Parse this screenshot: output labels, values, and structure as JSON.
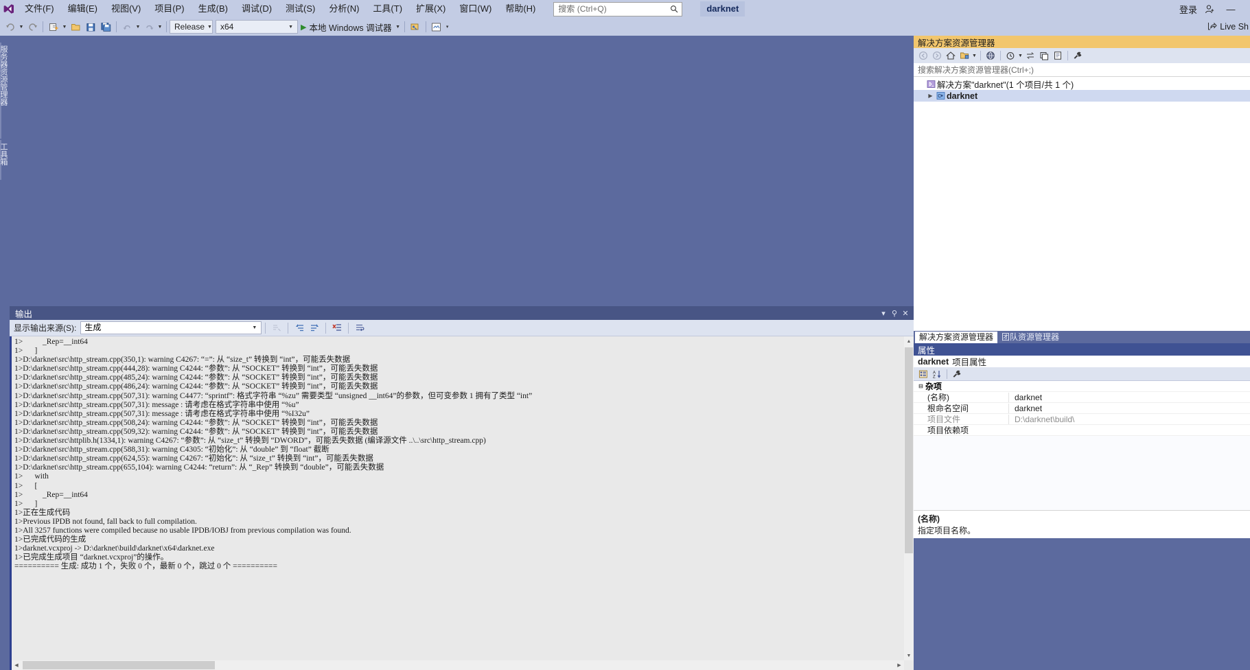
{
  "titlebar": {
    "menus": [
      "文件(F)",
      "编辑(E)",
      "视图(V)",
      "项目(P)",
      "生成(B)",
      "调试(D)",
      "测试(S)",
      "分析(N)",
      "工具(T)",
      "扩展(X)",
      "窗口(W)",
      "帮助(H)"
    ],
    "search_placeholder": "搜索 (Ctrl+Q)",
    "search_value": "",
    "project_chip": "darknet",
    "signin_label": "登录",
    "minimize_label": "—"
  },
  "toolbar": {
    "config": "Release",
    "platform": "x64",
    "run_label": "本地 Windows 调试器",
    "live_share": "Live Sh"
  },
  "left_strip": {
    "tabs": [
      "服务器资源管理器",
      "工具箱"
    ]
  },
  "output": {
    "title": "输出",
    "source_label": "显示输出来源(S):",
    "source_value": "生成",
    "controls": {
      "dropdown": "▾",
      "pin": "⚲",
      "close": "✕"
    },
    "lines": [
      "1>          _Rep=__int64",
      "1>      ]",
      "1>D:\\darknet\\src\\http_stream.cpp(350,1): warning C4267: “=”: 从 “size_t” 转换到 “int”，可能丢失数据",
      "1>D:\\darknet\\src\\http_stream.cpp(444,28): warning C4244: “参数”: 从 “SOCKET” 转换到 “int”，可能丢失数据",
      "1>D:\\darknet\\src\\http_stream.cpp(485,24): warning C4244: “参数”: 从 “SOCKET” 转换到 “int”，可能丢失数据",
      "1>D:\\darknet\\src\\http_stream.cpp(486,24): warning C4244: “参数”: 从 “SOCKET” 转换到 “int”，可能丢失数据",
      "1>D:\\darknet\\src\\http_stream.cpp(507,31): warning C4477: “sprintf”: 格式字符串 “%zu” 需要类型 “unsigned __int64”的参数，但可变参数 1 拥有了类型 “int”",
      "1>D:\\darknet\\src\\http_stream.cpp(507,31): message : 请考虑在格式字符串中使用 “%u”",
      "1>D:\\darknet\\src\\http_stream.cpp(507,31): message : 请考虑在格式字符串中使用 “%I32u”",
      "1>D:\\darknet\\src\\http_stream.cpp(508,24): warning C4244: “参数”: 从 “SOCKET” 转换到 “int”，可能丢失数据",
      "1>D:\\darknet\\src\\http_stream.cpp(509,32): warning C4244: “参数”: 从 “SOCKET” 转换到 “int”，可能丢失数据",
      "1>D:\\darknet\\src\\httplib.h(1334,1): warning C4267: “参数”: 从 “size_t” 转换到 “DWORD”，可能丢失数据 (编译源文件 ..\\..\\src\\http_stream.cpp)",
      "1>D:\\darknet\\src\\http_stream.cpp(588,31): warning C4305: “初始化”: 从 “double” 到 “float” 截断",
      "1>D:\\darknet\\src\\http_stream.cpp(624,55): warning C4267: “初始化”: 从 “size_t” 转换到 “int”，可能丢失数据",
      "1>D:\\darknet\\src\\http_stream.cpp(655,104): warning C4244: “return”: 从 “_Rep” 转换到 “double”，可能丢失数据",
      "1>      with",
      "1>      [",
      "1>          _Rep=__int64",
      "1>      ]",
      "1>正在生成代码",
      "1>Previous IPDB not found, fall back to full compilation.",
      "1>All 3257 functions were compiled because no usable IPDB/IOBJ from previous compilation was found.",
      "1>已完成代码的生成",
      "1>darknet.vcxproj -> D:\\darknet\\build\\darknet\\x64\\darknet.exe",
      "1>已完成生成项目 “darknet.vcxproj”的操作。",
      "========== 生成: 成功 1 个，失败 0 个，最新 0 个，跳过 0 个 =========="
    ]
  },
  "solution_explorer": {
    "title": "解决方案资源管理器",
    "search_placeholder": "搜索解决方案资源管理器(Ctrl+;)",
    "tree": [
      {
        "indent": 0,
        "expander": "",
        "icon": "solution-icon",
        "label": "解决方案\"darknet\"(1 个项目/共 1 个)",
        "bold": false,
        "selected": false
      },
      {
        "indent": 1,
        "expander": "▶",
        "icon": "cpp-project-icon",
        "label": "darknet",
        "bold": true,
        "selected": true
      }
    ],
    "tabs": [
      {
        "label": "解决方案资源管理器",
        "active": true
      },
      {
        "label": "团队资源管理器",
        "active": false
      }
    ]
  },
  "properties": {
    "title": "属性",
    "header_name": "darknet",
    "header_suffix": "项目属性",
    "categories": [
      {
        "name": "杂项",
        "expander": "⊟",
        "rows": [
          {
            "key": "(名称)",
            "value": "darknet",
            "dim": false
          },
          {
            "key": "根命名空间",
            "value": "darknet",
            "dim": false
          },
          {
            "key": "项目文件",
            "value": "D:\\darknet\\build\\",
            "dim": true
          },
          {
            "key": "项目依赖项",
            "value": "",
            "dim": false
          }
        ]
      }
    ],
    "description": {
      "name": "(名称)",
      "text": "指定项目名称。"
    }
  },
  "colors": {
    "titlebar_bg": "#c3cce4",
    "workspace_bg": "#5c6a9e",
    "panel_title_orange": "#f2c66d",
    "panel_title_blue": "#3f5293",
    "output_bg": "#e9e9e9",
    "selection_blue": "#cfd9f0",
    "run_green": "#2d8b2d"
  }
}
